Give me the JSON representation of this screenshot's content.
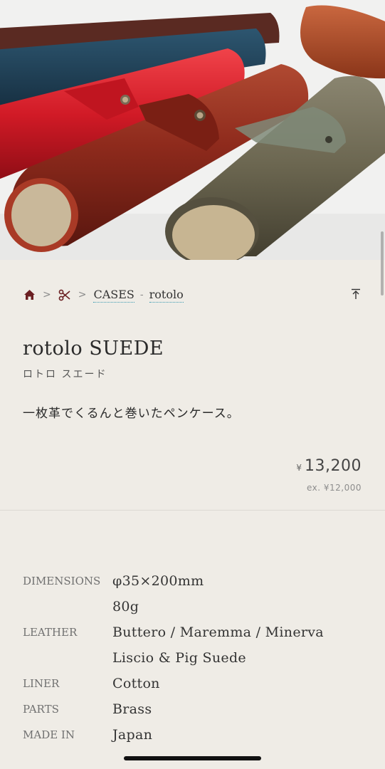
{
  "breadcrumb": {
    "home_icon": "home-icon",
    "category_icon": "scissors-icon",
    "separator": ">",
    "section": "CASES",
    "dash": "-",
    "item": "rotolo",
    "to_top_icon": "arrow-to-top-icon"
  },
  "product": {
    "title": "rotolo SUEDE",
    "kana": "ロトロ スエード",
    "description": "一枚革でくるんと巻いたペンケース。",
    "price_currency": "¥",
    "price": "13,200",
    "price_ex": "ex. ¥12,000"
  },
  "specs": [
    {
      "label": "DIMENSIONS",
      "values": [
        "φ35×200mm",
        "80g"
      ]
    },
    {
      "label": "LEATHER",
      "values": [
        "Buttero / Maremma / Minerva",
        "Liscio & Pig Suede"
      ]
    },
    {
      "label": "LINER",
      "values": [
        "Cotton"
      ]
    },
    {
      "label": "PARTS",
      "values": [
        "Brass"
      ]
    },
    {
      "label": "MADE IN",
      "values": [
        "Japan"
      ]
    }
  ],
  "colors": {
    "background": "#efece6",
    "accent_home": "#6b1f22",
    "link_underline": "#3a9ab2",
    "leather_red": "#d11a26",
    "leather_brown": "#8e2a1c",
    "leather_olive": "#6b6650",
    "leather_navy": "#1f3e52"
  }
}
